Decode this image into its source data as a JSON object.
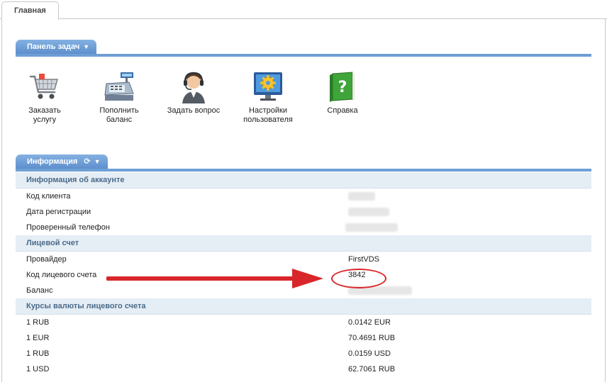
{
  "tabs": {
    "main": "Главная"
  },
  "taskbar": {
    "title": "Панель задач",
    "items": [
      {
        "label_1": "Заказать",
        "label_2": "услугу",
        "icon": "shopping-cart-icon"
      },
      {
        "label_1": "Пополнить",
        "label_2": "баланс",
        "icon": "cash-register-icon"
      },
      {
        "label_1": "Задать вопрос",
        "label_2": "",
        "icon": "support-operator-icon"
      },
      {
        "label_1": "Настройки",
        "label_2": "пользователя",
        "icon": "settings-monitor-icon"
      },
      {
        "label_1": "Справка",
        "label_2": "",
        "icon": "help-book-icon"
      }
    ]
  },
  "info": {
    "title": "Информация",
    "account": {
      "header": "Информация об аккаунте",
      "rows": [
        {
          "label": "Код клиента"
        },
        {
          "label": "Дата регистрации"
        },
        {
          "label": "Проверенный телефон"
        }
      ]
    },
    "personal_account": {
      "header": "Лицевой счет",
      "provider_label": "Провайдер",
      "provider_value": "FirstVDS",
      "account_code_label": "Код лицевого счета",
      "account_code_value": "3842",
      "balance_label": "Баланс"
    },
    "rates": {
      "header": "Курсы валюты лицевого счета",
      "rows": [
        {
          "from": "1 RUB",
          "to": "0.0142 EUR"
        },
        {
          "from": "1 EUR",
          "to": "70.4691 RUB"
        },
        {
          "from": "1 RUB",
          "to": "0.0159 USD"
        },
        {
          "from": "1 USD",
          "to": "62.7061 RUB"
        }
      ]
    }
  },
  "colors": {
    "accent": "#6e9fd6",
    "section_bg": "#e5edf5",
    "annotation": "#d9262a"
  }
}
